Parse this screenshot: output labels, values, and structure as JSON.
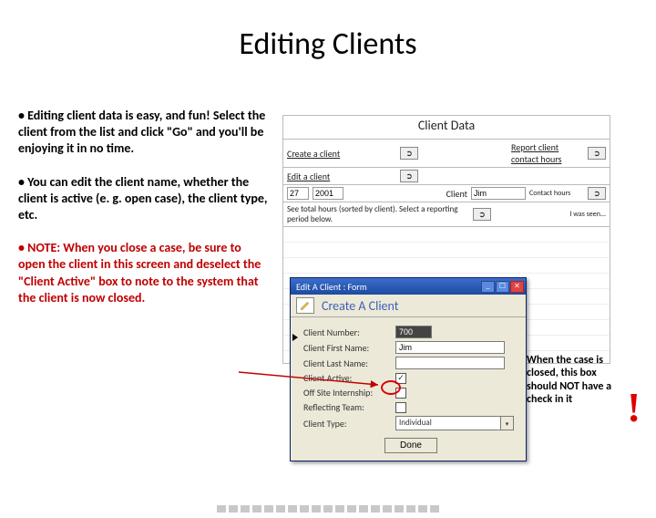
{
  "title": "Editing Clients",
  "bullets": {
    "b1": "• Editing client data is easy, and fun! Select the client from the list and click \"Go\" and you'll be enjoying it in no time.",
    "b2": "• You can edit the client name, whether the client is active (e. g. open case), the client type, etc.",
    "b3": "• NOTE: When you close a case, be sure to open the client in this screen and deselect the \"Client Active\" box to note to the system that the client is now closed."
  },
  "bg": {
    "heading": "Client Data",
    "create": "Create a client",
    "report": "Report client contact hours",
    "edit": "Edit a client",
    "year1": "27",
    "year2": "2001",
    "client_label": "Client",
    "client_value": "Jim",
    "contact": "Contact hours",
    "total": "See total hours (sorted by client). Select a reporting period below.",
    "seen": "I was seen..."
  },
  "form": {
    "titlebar": "Edit A Client : Form",
    "heading": "Create A Client",
    "labels": {
      "num": "Client Number:",
      "first": "Client First Name:",
      "last": "Client Last Name:",
      "active": "Client Active:",
      "offsite": "Off Site Internship:",
      "reflect": "Reflecting Team:",
      "type": "Client Type:"
    },
    "values": {
      "num": "700",
      "first": "Jim",
      "last": "",
      "active_check": "✓",
      "offsite_check": "",
      "reflect_check": "",
      "type": "Individual"
    },
    "done": "Done"
  },
  "annotation": "When the case is closed, this box should NOT have a check in it",
  "exclaim": "!"
}
